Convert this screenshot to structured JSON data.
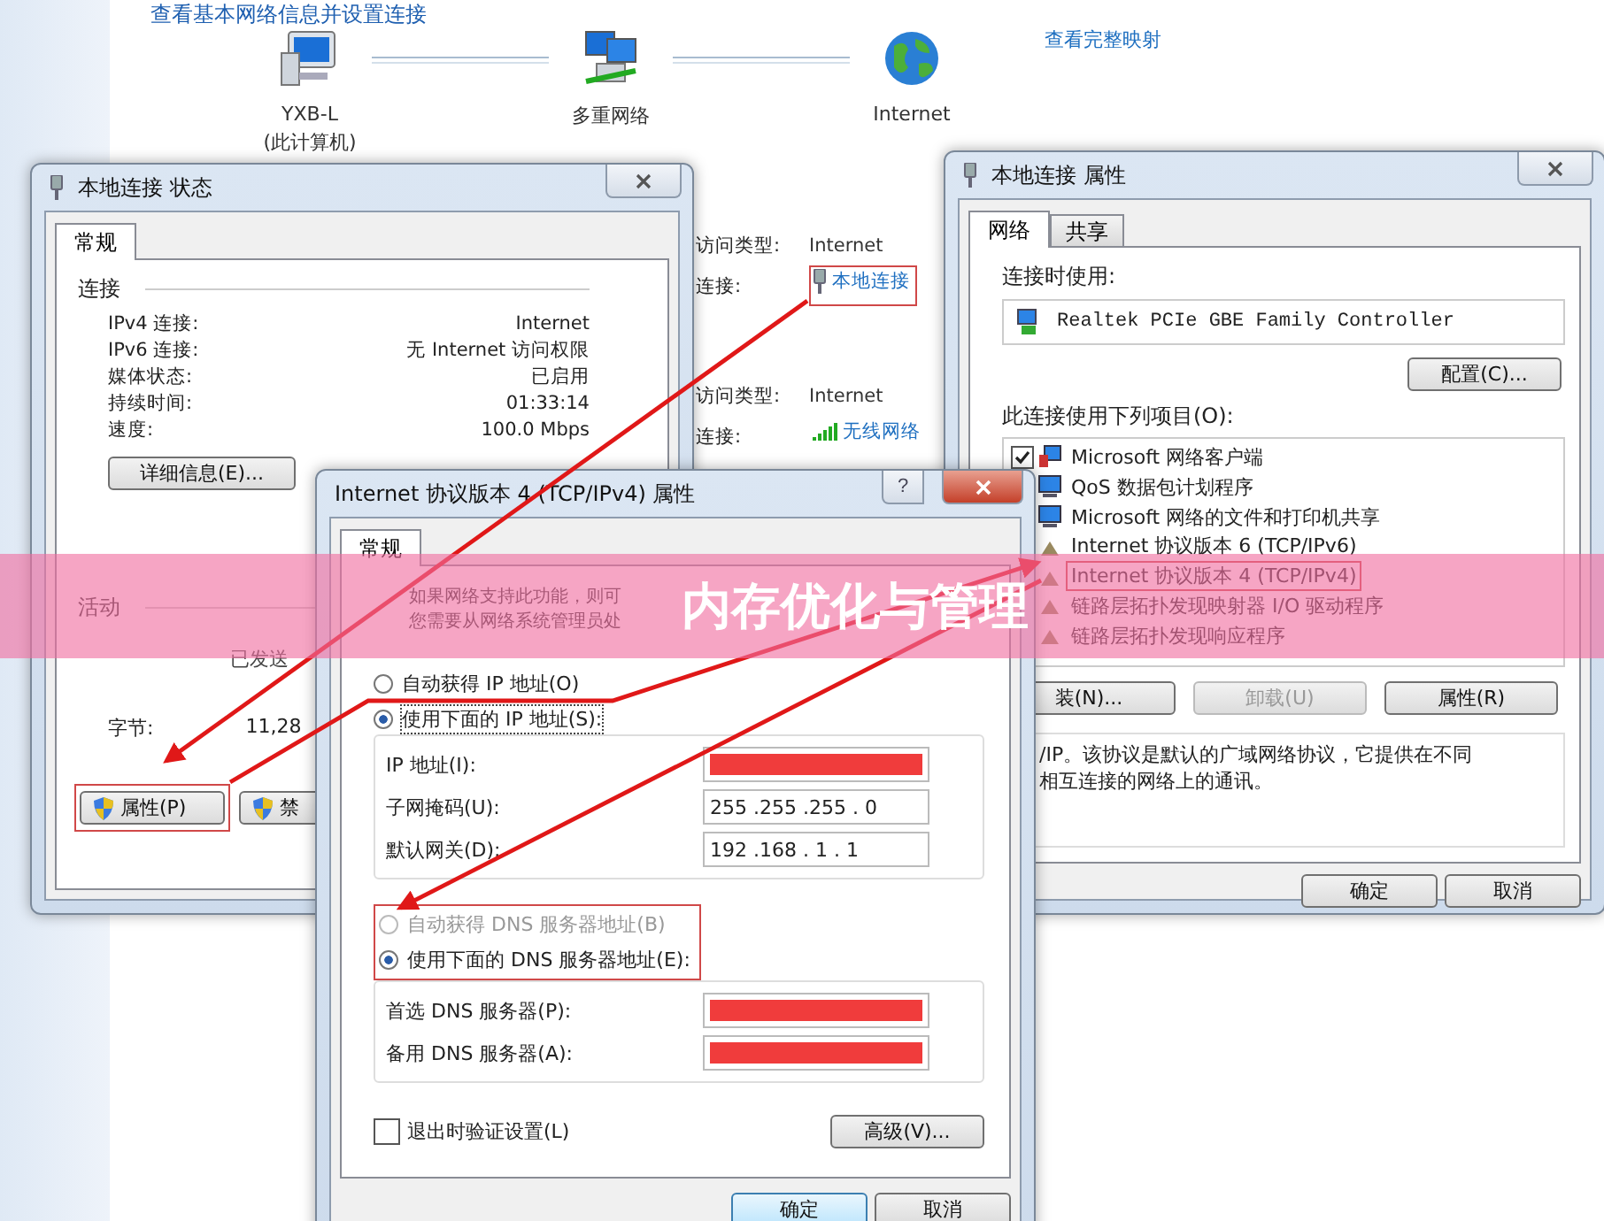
{
  "network_map": {
    "heading": "查看基本网络信息并设置连接",
    "link": "查看完整映射",
    "nodes": [
      {
        "kind": "computer",
        "label": "YXB-L",
        "sublabel": "(此计算机)"
      },
      {
        "kind": "network",
        "label": "多重网络"
      },
      {
        "kind": "internet",
        "label": "Internet"
      }
    ]
  },
  "networks": [
    {
      "kind": "wired",
      "access_type_label": "访问类型:",
      "access_type": "Internet",
      "connection_label": "连接:",
      "connection": "本地连接",
      "highlighted": true
    },
    {
      "kind": "wireless",
      "access_type_label": "访问类型:",
      "access_type": "Internet",
      "connection_label": "连接:",
      "connection": "无线网络",
      "highlighted": false
    }
  ],
  "status_window": {
    "title": "本地连接 状态",
    "tabs": [
      {
        "label": "常规",
        "selected": true
      }
    ],
    "connection_heading": "连接",
    "rows": [
      {
        "label": "IPv4 连接:",
        "value": "Internet"
      },
      {
        "label": "IPv6 连接:",
        "value": "无 Internet 访问权限"
      },
      {
        "label": "媒体状态:",
        "value": "已启用"
      },
      {
        "label": "持续时间:",
        "value": "01:33:14"
      },
      {
        "label": "速度:",
        "value": "100.0 Mbps"
      }
    ],
    "details_button": "详细信息(E)...",
    "activity_heading": "活动",
    "sent_label": "已发送",
    "bytes_label": "字节:",
    "bytes_sent": "11,28",
    "buttons": [
      {
        "label": "属性(P)",
        "highlighted": true
      },
      {
        "label": "禁",
        "highlighted": false
      }
    ]
  },
  "properties_window": {
    "title": "本地连接 属性",
    "tabs": [
      {
        "label": "网络",
        "selected": true
      },
      {
        "label": "共享",
        "selected": false
      }
    ],
    "connect_using_label": "连接时使用:",
    "adapter": "Realtek PCIe GBE Family Controller",
    "configure_button": "配置(C)...",
    "items_label": "此连接使用下列项目(O):",
    "items": [
      {
        "kind": "client",
        "label": "Microsoft 网络客户端",
        "checked": true,
        "highlighted": false
      },
      {
        "kind": "service",
        "label": "QoS 数据包计划程序",
        "highlighted": false
      },
      {
        "kind": "service",
        "label": "Microsoft 网络的文件和打印机共享",
        "highlighted": false
      },
      {
        "kind": "protocol",
        "label": "Internet 协议版本 6 (TCP/IPv6)",
        "highlighted": false
      },
      {
        "kind": "protocol",
        "label": "Internet 协议版本 4 (TCP/IPv4)",
        "highlighted": true
      },
      {
        "kind": "protocol",
        "label": "链路层拓扑发现映射器 I/O 驱动程序",
        "highlighted": false
      },
      {
        "kind": "protocol",
        "label": "链路层拓扑发现响应程序",
        "highlighted": false
      }
    ],
    "item_buttons": [
      {
        "label": "装(N)...",
        "disabled": false
      },
      {
        "label": "卸载(U)",
        "disabled": true
      },
      {
        "label": "属性(R)",
        "disabled": false
      }
    ],
    "description": [
      "/IP。该协议是默认的广域网络协议，它提供在不同",
      "相互连接的网络上的通讯。"
    ],
    "buttons": [
      "确定",
      "取消"
    ]
  },
  "ipv4_window": {
    "title": "Internet 协议版本 4 (TCP/IPv4) 属性",
    "help": "?",
    "tabs": [
      {
        "label": "常规",
        "selected": true
      }
    ],
    "intro": [
      "如果网络支持此功能，则可",
      "您需要从网络系统管理员处"
    ],
    "ip_options": [
      {
        "label": "自动获得 IP 地址(O)",
        "selected": false,
        "disabled": false
      },
      {
        "label": "使用下面的 IP 地址(S):",
        "selected": true,
        "disabled": false
      }
    ],
    "ip_fields": [
      {
        "label": "IP 地址(I):",
        "redacted": true
      },
      {
        "label": "子网掩码(U):",
        "value": "255 .255 .255 . 0",
        "redacted": false
      },
      {
        "label": "默认网关(D):",
        "value": "192 .168 . 1 . 1",
        "redacted": false
      }
    ],
    "dns_options_highlighted": true,
    "dns_options": [
      {
        "label": "自动获得 DNS 服务器地址(B)",
        "selected": false,
        "disabled": true
      },
      {
        "label": "使用下面的 DNS 服务器地址(E):",
        "selected": true,
        "disabled": false
      }
    ],
    "dns_fields": [
      {
        "label": "首选 DNS 服务器(P):",
        "redacted": true
      },
      {
        "label": "备用 DNS 服务器(A):",
        "redacted": true
      }
    ],
    "validate": {
      "label": "退出时验证设置(L)",
      "checked": false
    },
    "advanced_button": "高级(V)...",
    "buttons": [
      {
        "label": "确定",
        "default": true
      },
      {
        "label": "取消",
        "default": false
      }
    ]
  },
  "banner": {
    "title": "内存优化与管理"
  }
}
